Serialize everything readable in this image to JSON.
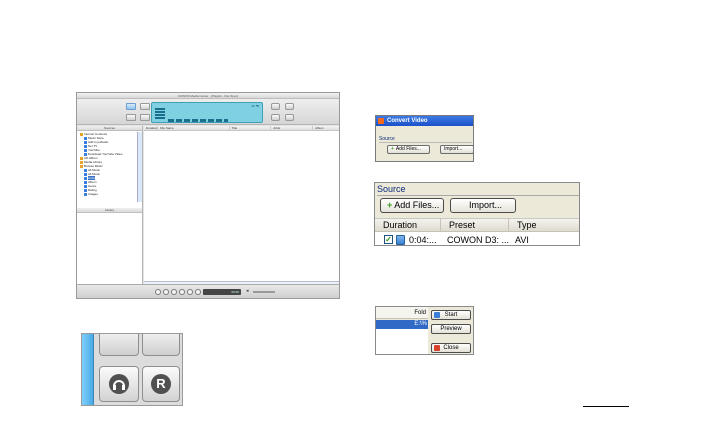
{
  "main_window": {
    "title": "COWON Media Center - (Playlist - File Open)",
    "lcd_text": "22 ℃",
    "left_pane_header": "Sources",
    "library_header": "Library",
    "tree": [
      {
        "label": "Internet Contents",
        "color": "#e5a32a"
      },
      {
        "label": "Music Store",
        "color": "#3a7ee0"
      },
      {
        "label": "Add to jetAudio",
        "color": "#3a7ee0"
      },
      {
        "label": "Net TV",
        "color": "#3a7ee0"
      },
      {
        "label": "YouTube",
        "color": "#3a7ee0"
      },
      {
        "label": "Download YouTube Video",
        "color": "#3a7ee0"
      },
      {
        "label": "CD Album",
        "color": "#e5a32a"
      },
      {
        "label": "Media Library",
        "color": "#e5a32a"
      },
      {
        "label": "Browse Music",
        "color": "#e5a32a"
      },
      {
        "label": "All Music",
        "color": "#3a7ee0"
      },
      {
        "label": "All Music",
        "color": "#3a7ee0"
      },
      {
        "label": "Artist",
        "color": "#3a7ee0"
      },
      {
        "label": "Album",
        "color": "#3a7ee0"
      },
      {
        "label": "Genre",
        "color": "#3a7ee0"
      },
      {
        "label": "Rating",
        "color": "#3a7ee0"
      },
      {
        "label": "Images",
        "color": "#3a7ee0"
      }
    ],
    "selected_tree_index": 11,
    "columns": [
      "Duration",
      "File Name",
      "Title",
      "Artist",
      "Album"
    ],
    "position_readout": "00:00"
  },
  "zoom_buttons": {
    "left_icon": "headphone-icon",
    "right_icon_letter": "R"
  },
  "convert_video": {
    "title": "Convert Video",
    "source_label": "Source",
    "add_files": "Add Files...",
    "import": "Import..."
  },
  "source_panel": {
    "label": "Source",
    "add_files": "Add Files...",
    "import": "Import...",
    "columns": [
      "Duration",
      "Preset",
      "Type"
    ],
    "row": {
      "duration": "0:04:...",
      "preset": "COWON D3: ...",
      "type": "AVI"
    }
  },
  "start_panel": {
    "header": "Fold",
    "selected_value": "E:\\%",
    "start": "Start",
    "preview": "Preview",
    "close": "Close"
  }
}
